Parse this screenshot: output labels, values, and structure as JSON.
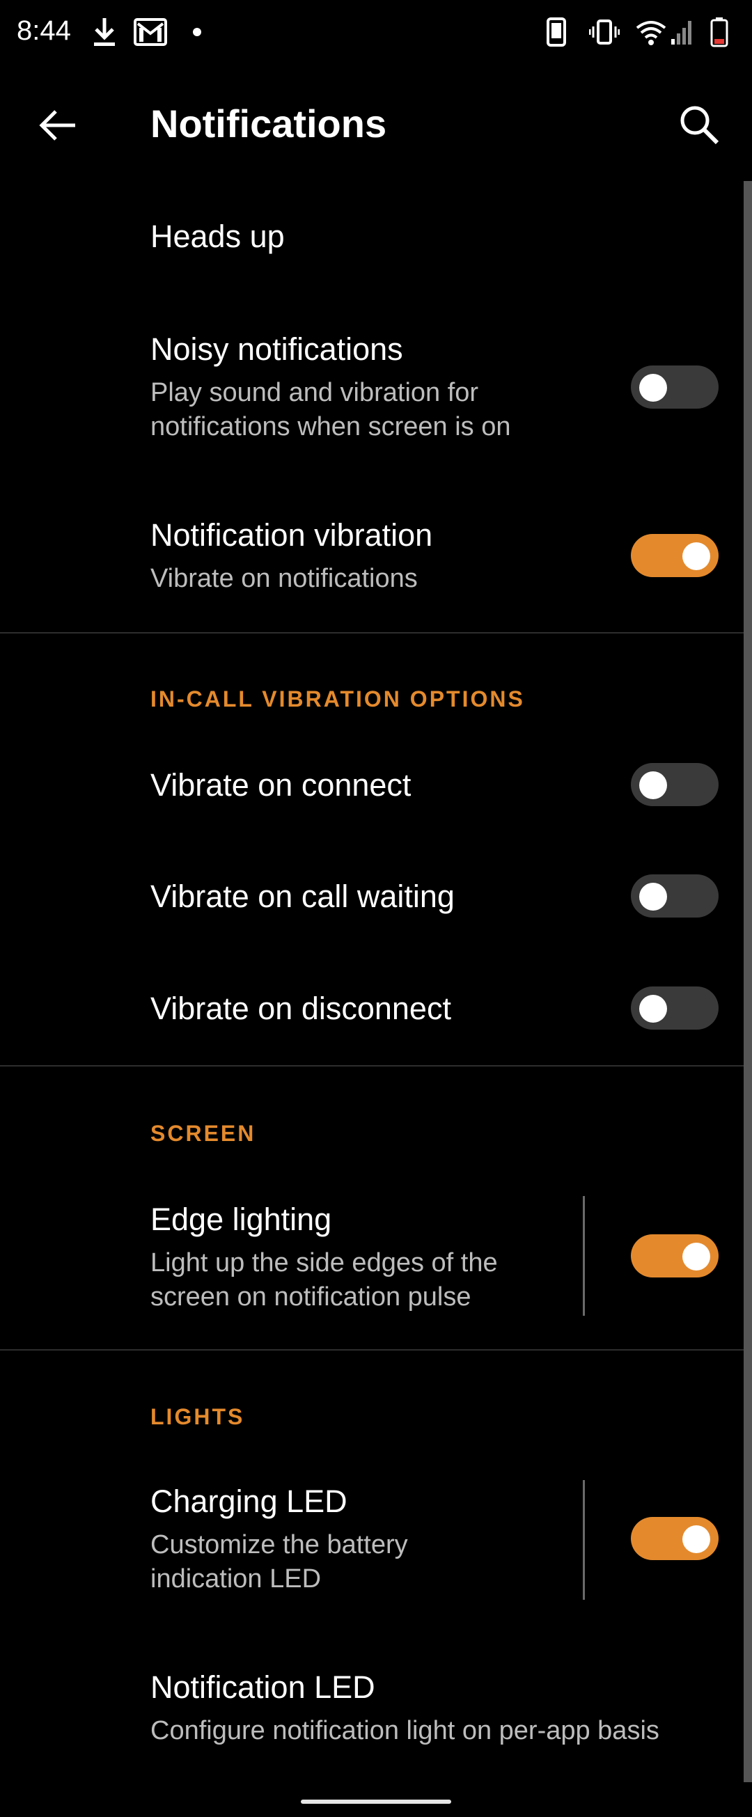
{
  "status": {
    "time": "8:44",
    "icons": [
      "download-icon",
      "gmail-icon",
      "dot-icon",
      "phone-icon",
      "vibrate-icon",
      "wifi-icon",
      "signal-icon",
      "battery-icon"
    ]
  },
  "appbar": {
    "title": "Notifications",
    "back_icon": "arrow-left-icon",
    "search_icon": "search-icon"
  },
  "items": {
    "heads_up": {
      "title": "Heads up"
    },
    "noisy": {
      "title": "Noisy notifications",
      "subtitle": "Play sound and vibration for notifications when screen is on",
      "on": false
    },
    "vibration": {
      "title": "Notification vibration",
      "subtitle": "Vibrate on notifications",
      "on": true
    },
    "vib_connect": {
      "title": "Vibrate on connect",
      "on": false
    },
    "vib_waiting": {
      "title": "Vibrate on call waiting",
      "on": false
    },
    "vib_disconnect": {
      "title": "Vibrate on disconnect",
      "on": false
    },
    "edge": {
      "title": "Edge lighting",
      "subtitle": "Light up the side edges of the screen on notification pulse",
      "on": true
    },
    "charging_led": {
      "title": "Charging LED",
      "subtitle": "Customize the battery indication LED",
      "on": true
    },
    "notif_led": {
      "title": "Notification LED",
      "subtitle": "Configure notification light on per-app basis"
    }
  },
  "sections": {
    "in_call": "IN-CALL VIBRATION OPTIONS",
    "screen": "SCREEN",
    "lights": "LIGHTS"
  },
  "colors": {
    "accent": "#e48a2d",
    "background": "#000000",
    "toggle_off": "#3a3a3a"
  }
}
